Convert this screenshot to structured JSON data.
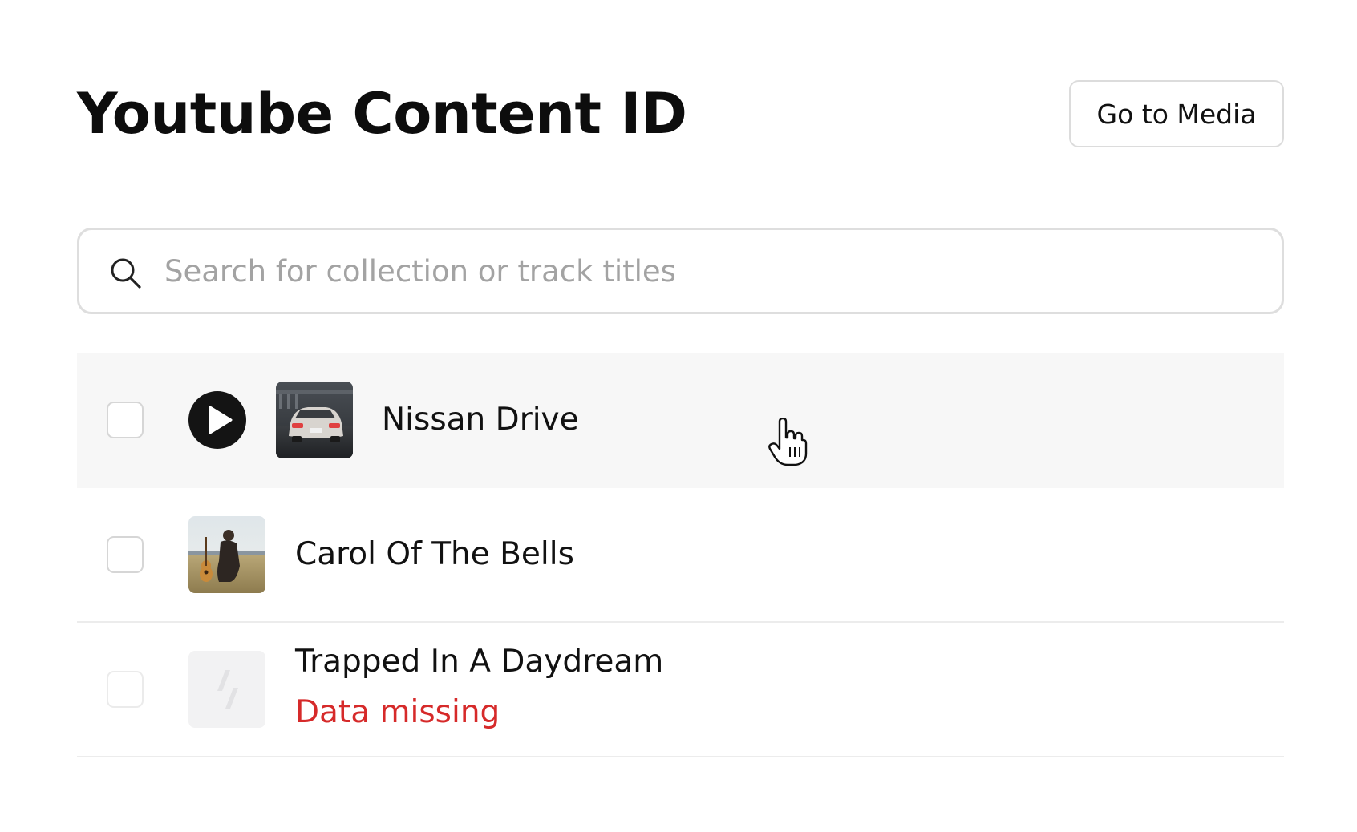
{
  "header": {
    "title": "Youtube Content ID",
    "go_to_media_label": "Go to Media"
  },
  "search": {
    "placeholder": "Search for collection or track titles",
    "value": ""
  },
  "tracks": [
    {
      "title": "Nissan Drive",
      "status": "",
      "has_play_button": true,
      "thumbnail": "car-thumbnail",
      "hovered": true
    },
    {
      "title": "Carol Of The Bells",
      "status": "",
      "has_play_button": false,
      "thumbnail": "guitarist-thumbnail",
      "hovered": false
    },
    {
      "title": "Trapped In A Daydream",
      "status": "Data missing",
      "has_play_button": false,
      "thumbnail": "placeholder-slash-icon",
      "hovered": false
    }
  ],
  "colors": {
    "warning": "#d62a2a",
    "hover_row": "#f7f7f7",
    "border": "#dedede"
  }
}
